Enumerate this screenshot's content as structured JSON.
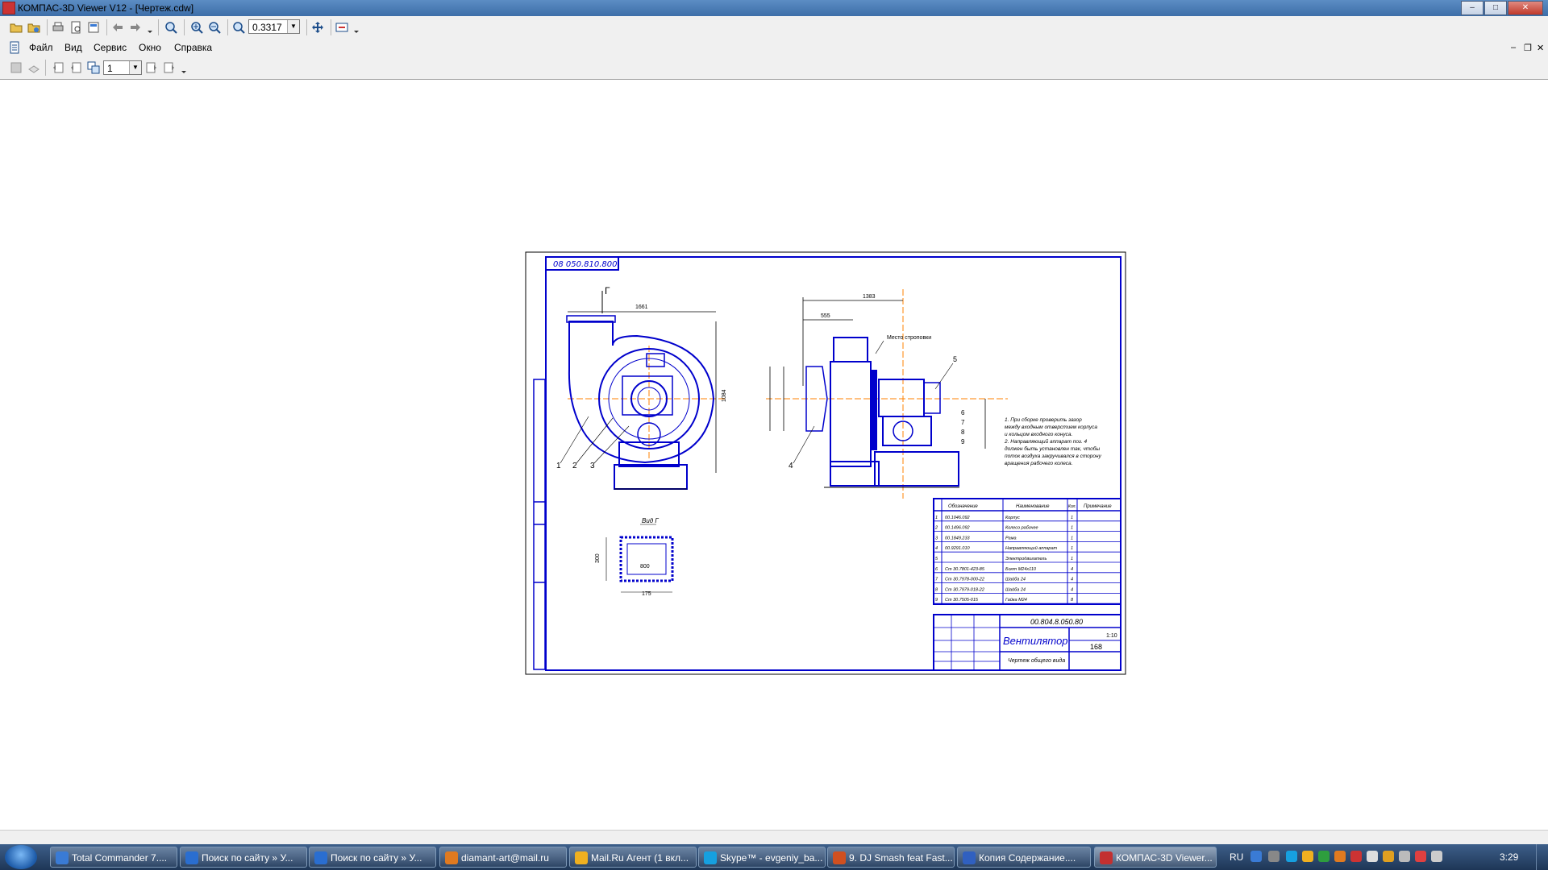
{
  "window": {
    "title": "КОМПАС-3D Viewer V12 - [Чертеж.cdw]",
    "minimize": "–",
    "maximize": "□",
    "close": "✕"
  },
  "toolbar": {
    "zoom_value": "0.3317"
  },
  "menu": {
    "items": [
      "Файл",
      "Вид",
      "Сервис",
      "Окно",
      "Справка"
    ],
    "mdi_minimize": "–",
    "mdi_restore": "❐",
    "mdi_close": "✕"
  },
  "toolbar2": {
    "page_value": "1"
  },
  "drawing": {
    "stamp_code": "08 050.810.800",
    "doc_code": "00.804.8.050.80",
    "name": "Вентилятор",
    "subtitle": "Чертеж общего вида",
    "scale": "1:10",
    "mass": "168",
    "view_label": "Вид Г",
    "letter_g": "Г",
    "dim_1661": "1661",
    "dim_1383": "1383",
    "dim_555": "555",
    "dim_1084": "1084",
    "dim_800": "800",
    "dim_300": "300",
    "dim_175": "175",
    "label_place": "Место строповки",
    "pos_1": "1",
    "pos_2": "2",
    "pos_3": "3",
    "pos_4": "4",
    "pos_5": "5",
    "pos_6": "6",
    "pos_7": "7",
    "pos_8": "8",
    "pos_9": "9",
    "notes": [
      "1. При сборке проверить зазор",
      "между входным отверстием корпуса",
      "и кольцом входного конуса.",
      "2. Направляющий аппарат поз. 4",
      "должен быть установлен так, чтобы",
      "поток воздуха закручивался в сторону",
      "вращения рабочего колеса."
    ],
    "spec_headers": [
      "Обозначение",
      "Наименование",
      "Кол.",
      "Примечание"
    ],
    "spec_rows": [
      {
        "n": "1",
        "code": "00.1046.092",
        "name": "Корпус",
        "qty": "1"
      },
      {
        "n": "2",
        "code": "00.1496.092",
        "name": "Колесо рабочее",
        "qty": "1"
      },
      {
        "n": "3",
        "code": "00.1849.233",
        "name": "Рама",
        "qty": "1"
      },
      {
        "n": "4",
        "code": "00.9291.010",
        "name": "Направляющий аппарат",
        "qty": "1"
      },
      {
        "n": "5",
        "code": "",
        "name": "Электродвигатель",
        "qty": "1"
      },
      {
        "n": "6",
        "code": "Ст 30.7801-423-85",
        "name": "Болт М24х110",
        "qty": "4"
      },
      {
        "n": "7",
        "code": "Ст 30.7978-000-22",
        "name": "Шайба 24",
        "qty": "4"
      },
      {
        "n": "8",
        "code": "Ст 30.7979-018-22",
        "name": "Шайба 24",
        "qty": "4"
      },
      {
        "n": "9",
        "code": "Ст 30.7505-015",
        "name": "Гайка М24",
        "qty": "8"
      }
    ]
  },
  "taskbar": {
    "tasks": [
      {
        "label": "Total Commander 7....",
        "color": "#3a7bd5"
      },
      {
        "label": "Поиск по сайту » У...",
        "color": "#2a6ed0"
      },
      {
        "label": "Поиск по сайту » У...",
        "color": "#2a6ed0"
      },
      {
        "label": "diamant-art@mail.ru",
        "color": "#e07a20"
      },
      {
        "label": "Mail.Ru Агент (1 вкл...",
        "color": "#f0b020"
      },
      {
        "label": "Skype™ - evgeniy_ba...",
        "color": "#16a0e0"
      },
      {
        "label": "9. DJ Smash feat Fast...",
        "color": "#d05020"
      },
      {
        "label": "Копия Содержание....",
        "color": "#3060c0"
      },
      {
        "label": "КОМПАС-3D Viewer...",
        "color": "#c33030"
      }
    ],
    "lang": "RU",
    "clock": "3:29"
  }
}
